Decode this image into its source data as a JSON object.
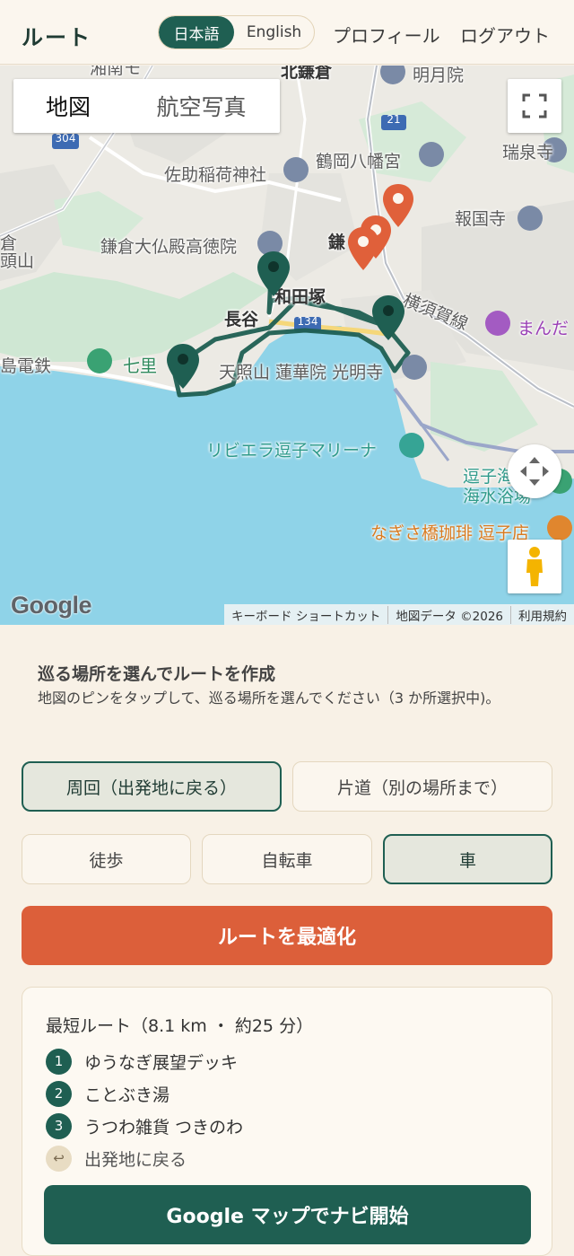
{
  "header": {
    "brand": "ルート",
    "lang_ja": "日本語",
    "lang_en": "English",
    "profile": "プロフィール",
    "logout": "ログアウト"
  },
  "map": {
    "toggle_map": "地図",
    "toggle_satellite": "航空写真",
    "google_logo": "Google",
    "attribution": {
      "shortcuts": "キーボード ショートカット",
      "data": "地図データ ©2026",
      "terms": "利用規約"
    },
    "labels": {
      "kitakamakura": "北鎌倉",
      "meigetsuin": "明月院",
      "tsurugaoka": "鶴岡八幡宮",
      "zuisenji": "瑞泉寺",
      "sasuke": "佐助稲荷神社",
      "hokokuji": "報国寺",
      "daibutsu": "鎌倉大仏殿高徳院",
      "kama": "鎌",
      "kura_left": "倉",
      "yama_left": "頭山",
      "wadazuka": "和田塚",
      "hase": "長谷",
      "yokosuka_line": "横須賀線",
      "manda": "まんだ",
      "enoden": "島電鉄",
      "shichiri": "七里",
      "komyoji": "天照山 蓮華院 光明寺",
      "riviera": "リビエラ逗子マリーナ",
      "zushi_beach_1": "逗子海",
      "zushi_beach_2": "海水浴場",
      "nagisa": "なぎさ橋珈琲 逗子店",
      "road_21": "21",
      "road_304": "304",
      "road_134": "134",
      "shonan": "湘南モ"
    },
    "colors": {
      "water": "#8fd3e8",
      "route": "#1f5f52",
      "pin_selected": "#1f5f52",
      "pin_place": "#e0603a"
    }
  },
  "panel": {
    "title": "巡る場所を選んでルートを作成",
    "description": "地図のピンをタップして、巡る場所を選んでください（3 か所選択中)。",
    "trip_options": {
      "loop": "周回（出発地に戻る）",
      "oneway": "片道（別の場所まで）",
      "selected": "loop"
    },
    "transport_options": {
      "walk": "徒歩",
      "bike": "自転車",
      "car": "車",
      "selected": "car"
    },
    "optimize_button": "ルートを最適化",
    "result": {
      "title": "最短ルート（8.1 km ・ 約25 分）",
      "stops": [
        {
          "num": "1",
          "name": "ゆうなぎ展望デッキ"
        },
        {
          "num": "2",
          "name": "ことぶき湯"
        },
        {
          "num": "3",
          "name": "うつわ雑貨 つきのわ"
        }
      ],
      "return_icon": "↩",
      "return_label": "出発地に戻る",
      "nav_button": "Google マップでナビ開始"
    }
  }
}
